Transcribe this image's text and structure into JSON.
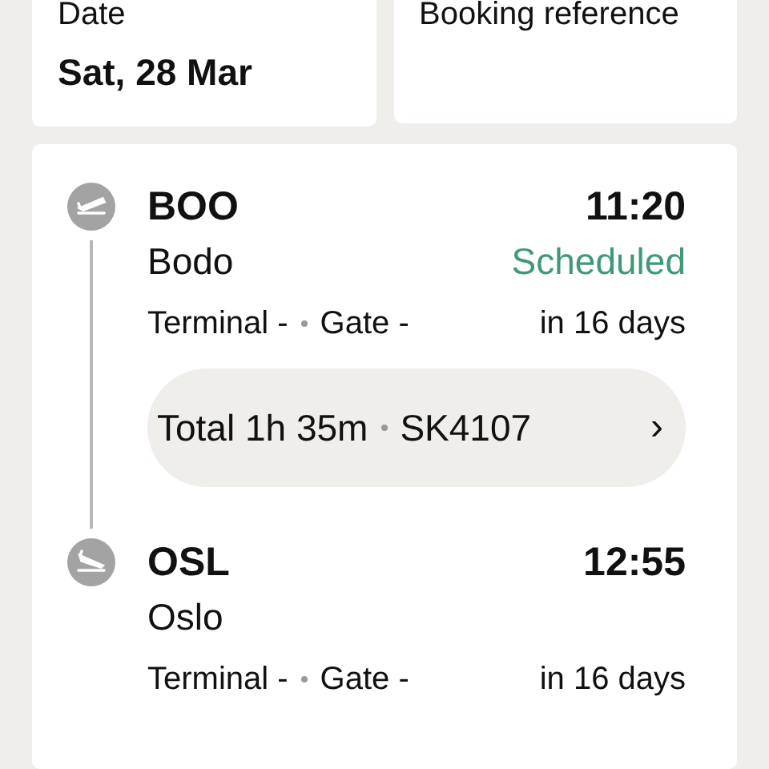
{
  "summary": [
    {
      "label": "Date",
      "value": "Sat, 28 Mar"
    },
    {
      "label": "Booking reference"
    }
  ],
  "stops": [
    {
      "kind": "departure",
      "code": "BOO",
      "time": "11:20",
      "city": "Bodo",
      "status": "Scheduled",
      "terminal": "Terminal -",
      "gate": "Gate -",
      "relative": "in 16 days"
    },
    {
      "kind": "arrival",
      "code": "OSL",
      "time": "12:55",
      "city": "Oslo",
      "terminal": "Terminal -",
      "gate": "Gate -",
      "relative": "in 16 days"
    }
  ],
  "leg": {
    "duration": "Total 1h 35m",
    "flight": "SK4107",
    "chevron": "›"
  }
}
